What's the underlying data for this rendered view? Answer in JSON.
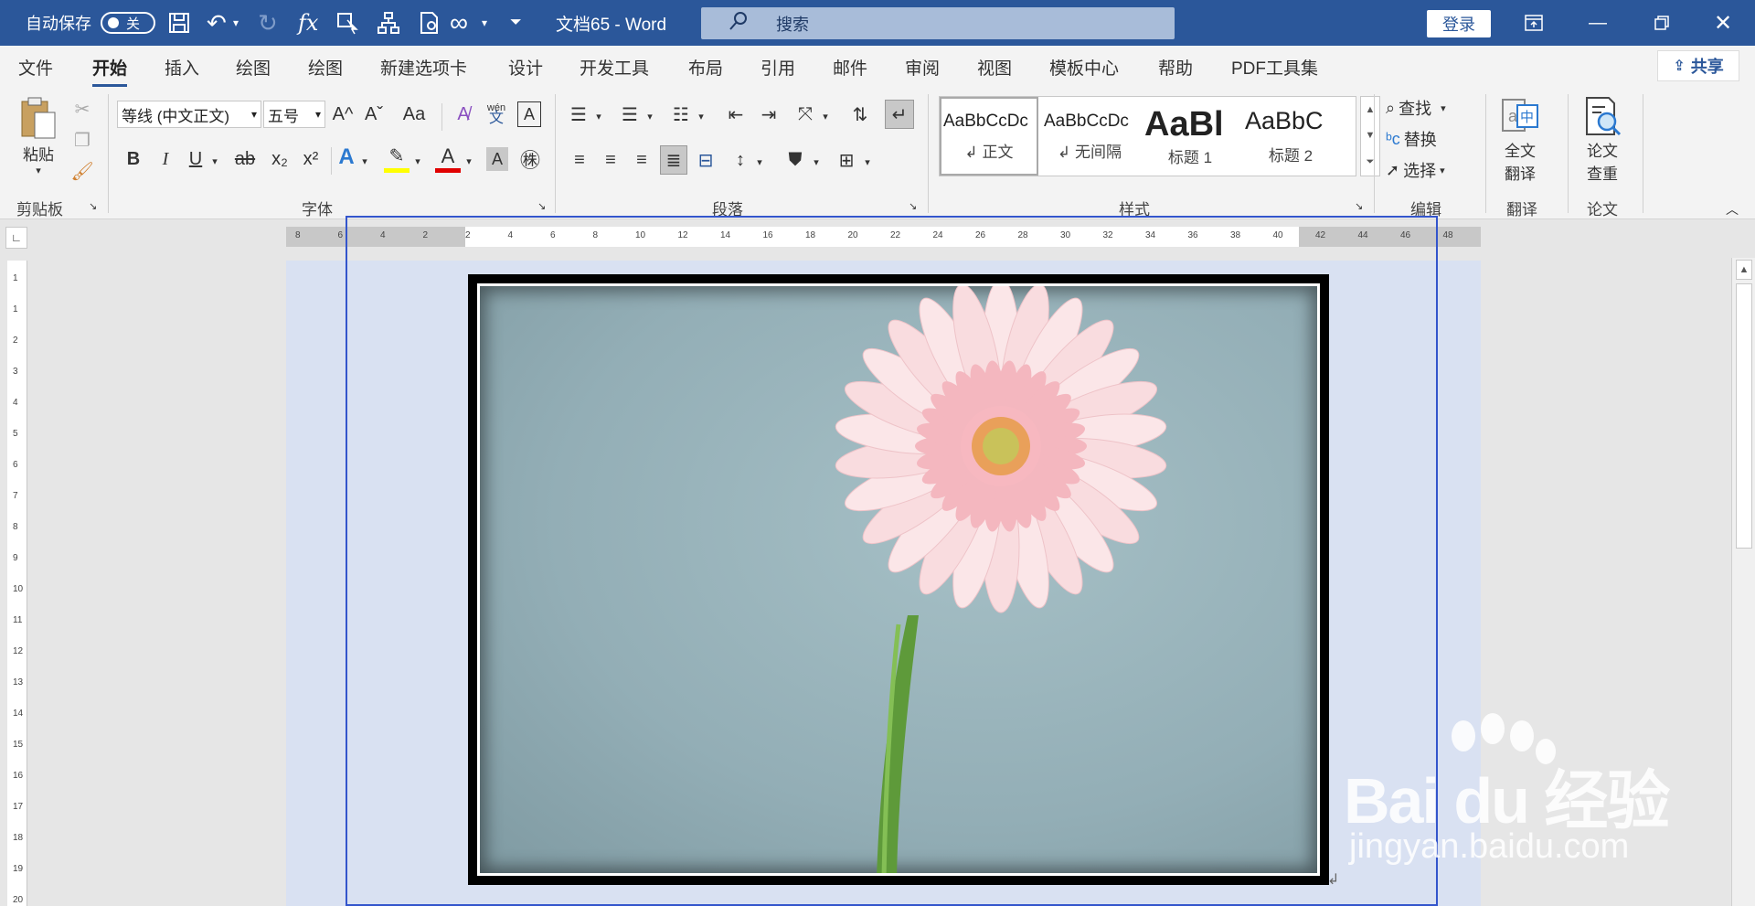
{
  "titlebar": {
    "autosave_label": "自动保存",
    "autosave_state": "关",
    "doc_title": "文档65  -  Word",
    "search_placeholder": "搜索",
    "login_label": "登录"
  },
  "tabs": [
    "文件",
    "开始",
    "插入",
    "绘图",
    "绘图",
    "新建选项卡",
    "设计",
    "开发工具",
    "布局",
    "引用",
    "邮件",
    "审阅",
    "视图",
    "模板中心",
    "帮助",
    "PDF工具集"
  ],
  "active_tab": "开始",
  "share_label": "共享",
  "clipboard": {
    "paste_label": "粘贴",
    "group_label": "剪贴板"
  },
  "font": {
    "font_name": "等线 (中文正文)",
    "font_size": "五号",
    "group_label": "字体",
    "bold": "B",
    "italic": "I",
    "underline": "U",
    "strike": "ab",
    "subscript": "x₂",
    "superscript": "x²",
    "grow": "A^",
    "shrink": "Aˇ",
    "change_case": "Aa",
    "phonetic": "wén",
    "phonetic_sub": "文"
  },
  "paragraph": {
    "group_label": "段落"
  },
  "styles": {
    "group_label": "样式",
    "items": [
      {
        "sample": "AaBbCcDc",
        "name": "↲ 正文"
      },
      {
        "sample": "AaBbCcDc",
        "name": "↲ 无间隔"
      },
      {
        "sample": "AaBl",
        "name": "标题 1"
      },
      {
        "sample": "AaBbC",
        "name": "标题 2"
      }
    ]
  },
  "editing": {
    "find": "查找",
    "replace": "替换",
    "select": "选择",
    "group_label": "编辑"
  },
  "translate": {
    "label_line1": "全文",
    "label_line2": "翻译",
    "group_label": "翻译"
  },
  "paper": {
    "label_line1": "论文",
    "label_line2": "查重",
    "group_label": "论文"
  },
  "ruler_h": [
    "8",
    "6",
    "4",
    "2",
    "2",
    "4",
    "6",
    "8",
    "10",
    "12",
    "14",
    "16",
    "18",
    "20",
    "22",
    "24",
    "26",
    "28",
    "30",
    "32",
    "34",
    "36",
    "38",
    "40",
    "42",
    "44",
    "46",
    "48"
  ],
  "ruler_v": [
    "1",
    "1",
    "2",
    "3",
    "4",
    "5",
    "6",
    "7",
    "8",
    "9",
    "10",
    "11",
    "12",
    "13",
    "14",
    "15",
    "16",
    "17",
    "18",
    "19",
    "20"
  ],
  "watermark": {
    "main": "Bai du 经验",
    "sub": "jingyan.baidu.com"
  },
  "colors": {
    "accent": "#2b579a",
    "page_bg": "#d9e1f2",
    "selection": "#3355cc"
  }
}
